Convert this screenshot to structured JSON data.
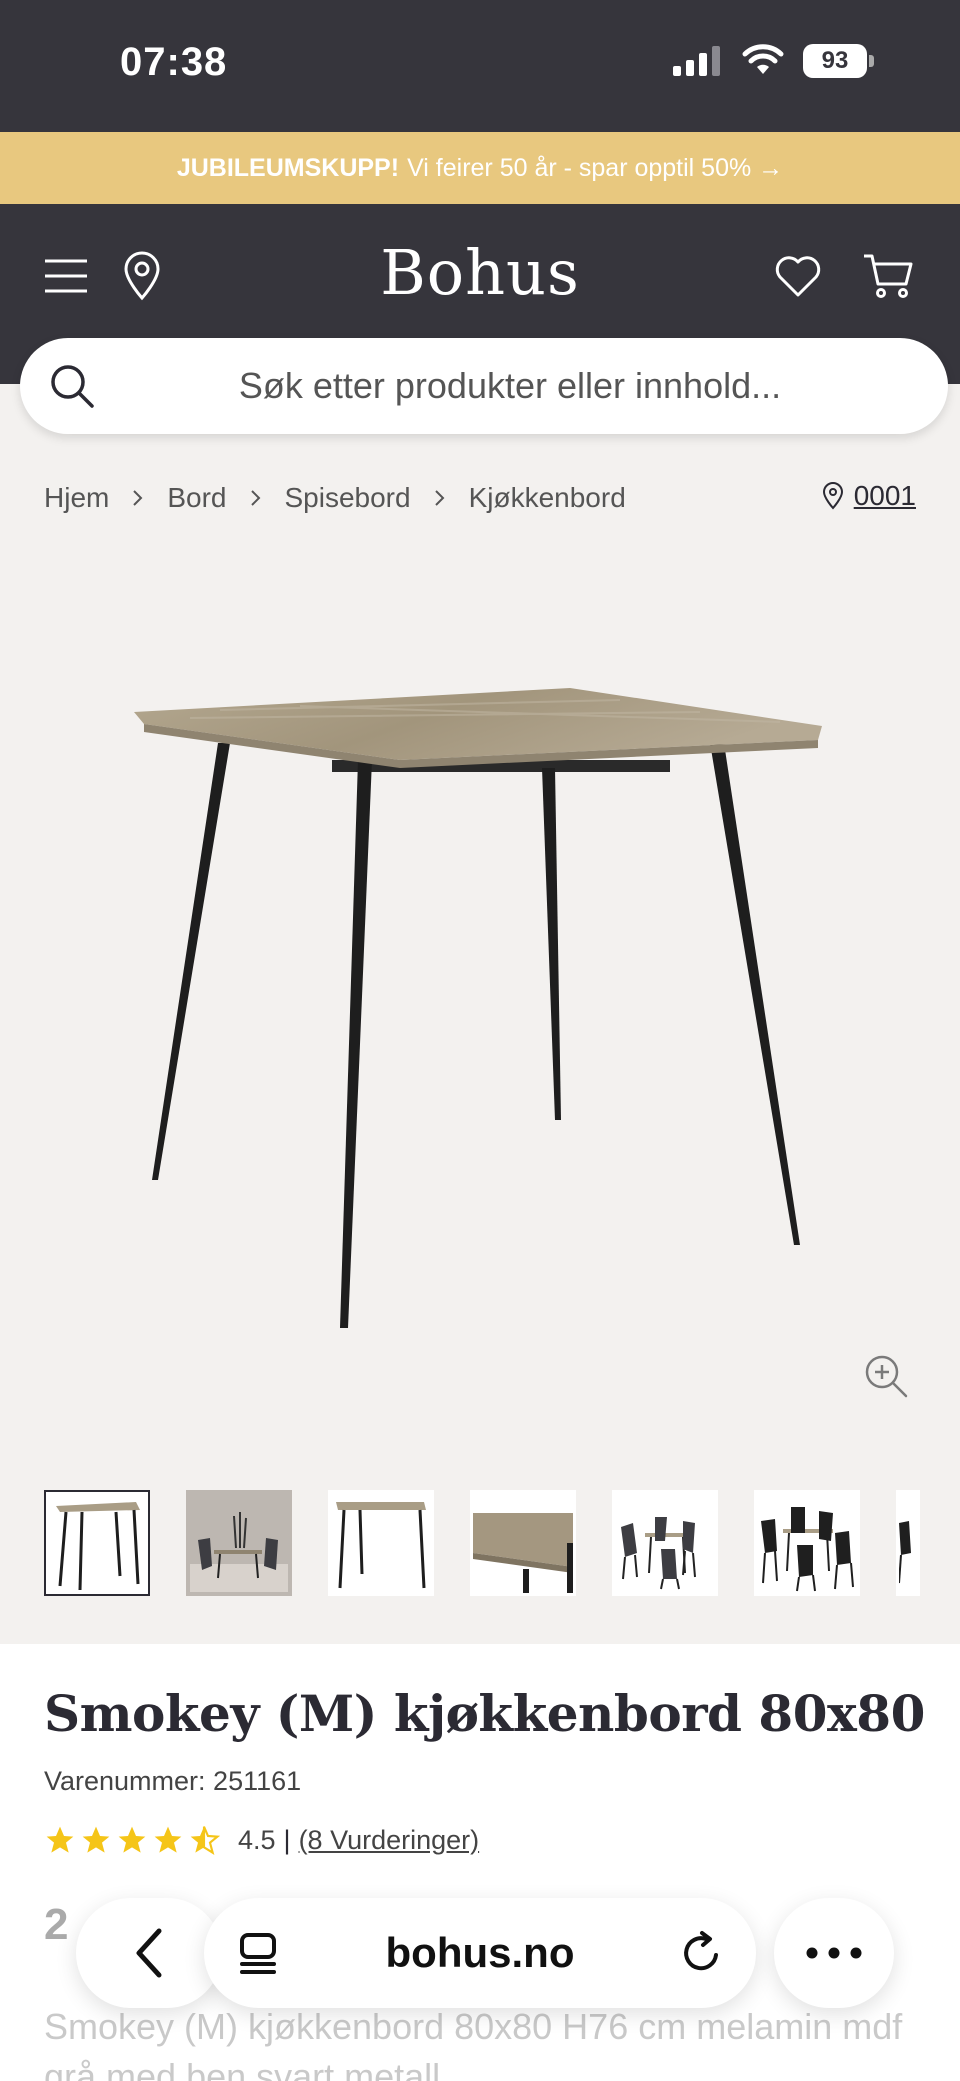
{
  "status_bar": {
    "time": "07:38",
    "battery": "93"
  },
  "promo": {
    "bold": "JUBILEUMSKUPP!",
    "text": "Vi feirer 50 år - spar opptil 50% →"
  },
  "header": {
    "logo": "Bohus",
    "menu_icon": "hamburger-menu-icon",
    "location_icon": "map-pin-icon",
    "wishlist_icon": "heart-icon",
    "cart_icon": "cart-icon"
  },
  "search": {
    "placeholder": "Søk etter produkter eller innhold..."
  },
  "breadcrumb": {
    "items": [
      "Hjem",
      "Bord",
      "Spisebord",
      "Kjøkkenbord"
    ],
    "store_code": "0001"
  },
  "gallery": {
    "thumbnail_count_visible": 7,
    "active_index": 0
  },
  "product": {
    "title": "Smokey (M) kjøkkenbord 80x80",
    "sku": "Varenummer: 251161",
    "rating_value": "4.5",
    "rating_separator": "|",
    "rating_count": "(8 Vurderinger)",
    "stars": 4.5,
    "price_partial": "2",
    "description": "Smokey (M) kjøkkenbord 80x80 H76 cm melamin mdf grå med ben svart metall"
  },
  "browser": {
    "url": "bohus.no"
  },
  "colors": {
    "header_bg": "#36353c",
    "promo_bg": "#e8c87f",
    "star": "#f5c518",
    "page_bg": "#f3f1ef"
  }
}
